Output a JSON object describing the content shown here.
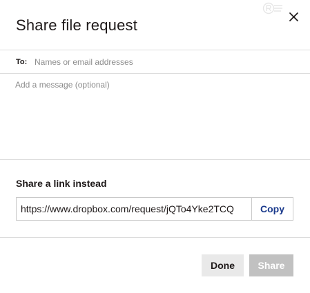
{
  "dialog": {
    "title": "Share file request",
    "close_icon": "close-icon"
  },
  "recipients": {
    "label": "To:",
    "placeholder": "Names or email addresses",
    "value": ""
  },
  "message": {
    "placeholder": "Add a message (optional)",
    "value": ""
  },
  "share_link": {
    "heading": "Share a link instead",
    "url": "https://www.dropbox.com/request/jQTo4Yke2TCQ",
    "copy_label": "Copy"
  },
  "actions": {
    "done_label": "Done",
    "share_label": "Share"
  },
  "colors": {
    "copy_text": "#1a3a8c",
    "done_bg": "#e9e9e9",
    "share_bg_disabled": "#c1c1c1",
    "divider": "#dcdcdc"
  }
}
